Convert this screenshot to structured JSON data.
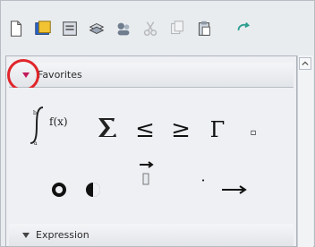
{
  "toolbar": {
    "buttons": [
      {
        "name": "new-document-icon"
      },
      {
        "name": "palette-icon"
      },
      {
        "name": "template-icon"
      },
      {
        "name": "layers-icon"
      },
      {
        "name": "users-icon"
      },
      {
        "name": "cut-icon",
        "disabled": true
      },
      {
        "name": "copy-icon",
        "disabled": true
      },
      {
        "name": "paste-icon"
      },
      {
        "name": "redo-icon"
      }
    ]
  },
  "sections": {
    "favorites": {
      "label": "Favorites",
      "expanded": true
    },
    "expression": {
      "label": "Expression",
      "expanded": true
    }
  },
  "favorites": {
    "symbols": {
      "integral": "∫",
      "summation": "∑",
      "less_equal": "≤",
      "greater_equal": "≥",
      "gamma": "Γ",
      "small": "▫",
      "vector": "→",
      "arrow": "→",
      "dot": "·"
    }
  },
  "colors": {
    "highlight": "#e0262b",
    "toggle": "#c2185b"
  }
}
